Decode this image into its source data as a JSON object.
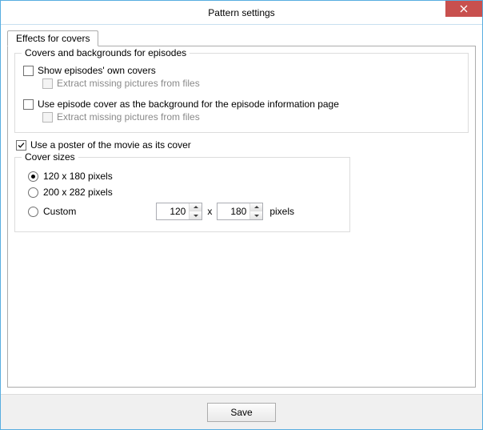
{
  "window": {
    "title": "Pattern settings",
    "close_icon": "close-icon"
  },
  "tab": {
    "effects_for_covers": "Effects for covers"
  },
  "group_covers": {
    "legend": "Covers and backgrounds for episodes",
    "show_own_covers": {
      "label": "Show episodes' own covers",
      "checked": false
    },
    "extract1": {
      "label": "Extract missing pictures from files",
      "checked": false,
      "disabled": true
    },
    "use_as_bg": {
      "label": "Use episode cover as the background for the episode information page",
      "checked": false
    },
    "extract2": {
      "label": "Extract missing pictures from files",
      "checked": false,
      "disabled": true
    }
  },
  "use_poster": {
    "label": "Use a poster of the movie as its cover",
    "checked": true
  },
  "group_sizes": {
    "legend": "Cover sizes",
    "opt_120": {
      "label": "120 x 180 pixels",
      "selected": true
    },
    "opt_200": {
      "label": "200 x 282 pixels",
      "selected": false
    },
    "opt_custom": {
      "label": "Custom",
      "selected": false
    },
    "custom_w": "120",
    "custom_h": "180",
    "x": "x",
    "px": "pixels"
  },
  "footer": {
    "save": "Save"
  }
}
